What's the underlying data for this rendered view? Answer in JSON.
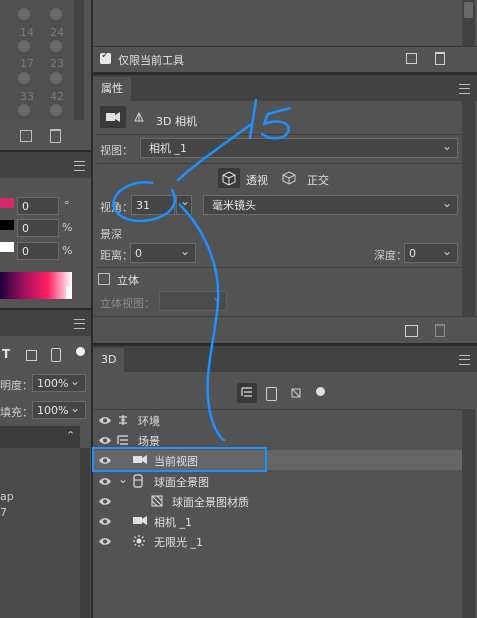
{
  "top_panel": {
    "toggle_label": "仅限当前工具",
    "toggle_checked": true,
    "grid_numbers": [
      "14",
      "24",
      "17",
      "23",
      "33",
      "42"
    ]
  },
  "properties": {
    "tab_label": "属性",
    "header_title": "3D 相机",
    "view_label": "视图：",
    "view_value": "相机 _1",
    "perspective_label": "透视",
    "ortho_label": "正交",
    "fov_label": "视角：",
    "fov_value": "31",
    "fov_unit": "毫米镜头",
    "dof_label": "景深",
    "distance_label": "距离：",
    "distance_value": "0",
    "depth_label": "深度：",
    "depth_value": "0",
    "stereo_label": "立体",
    "stereo_view_label": "立体视图："
  },
  "left_panel": {
    "values": [
      "0",
      "0",
      "0"
    ],
    "units": [
      "°",
      "%",
      "%"
    ],
    "opacity_label": "明度：",
    "opacity_value": "100%",
    "fill_label": "填充：",
    "fill_value": "100%",
    "clip_texts": [
      "ap",
      "7"
    ]
  },
  "threed": {
    "tab_label": "3D",
    "layers": [
      {
        "label": "环境",
        "icon": "environment-icon",
        "indent": 0,
        "selected": false
      },
      {
        "label": "场景",
        "icon": "scene-icon",
        "indent": 0,
        "selected": false
      },
      {
        "label": "当前视图",
        "icon": "camera-icon",
        "indent": 1,
        "selected": true
      },
      {
        "label": "球面全景图",
        "icon": "panorama-icon",
        "indent": 1,
        "selected": false
      },
      {
        "label": "球面全景图材质",
        "icon": "material-icon",
        "indent": 2,
        "selected": false
      },
      {
        "label": "相机 _1",
        "icon": "camera-icon",
        "indent": 1,
        "selected": false
      },
      {
        "label": "无限光 _1",
        "icon": "light-icon",
        "indent": 1,
        "selected": false
      }
    ]
  },
  "annotation": {
    "handwritten_text": "15",
    "color": "#1e90ff"
  },
  "colors": {
    "accent": "#1e90ff",
    "panel": "#535353",
    "header": "#424242",
    "selected_row": "#656565"
  }
}
